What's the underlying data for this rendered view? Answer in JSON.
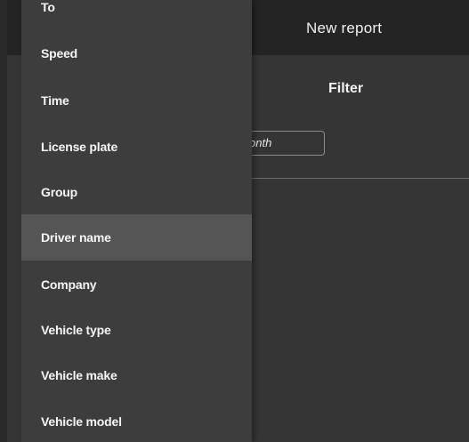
{
  "header": {
    "title": "New report"
  },
  "filter": {
    "title": "Filter",
    "period_value": "onth"
  },
  "dropdown": {
    "items": [
      {
        "label": "To"
      },
      {
        "label": "Speed"
      },
      {
        "label": "Time"
      },
      {
        "label": "License plate"
      },
      {
        "label": "Group"
      },
      {
        "label": "Driver name",
        "selected": true
      },
      {
        "label": "Company"
      },
      {
        "label": "Vehicle type"
      },
      {
        "label": "Vehicle make"
      },
      {
        "label": "Vehicle model"
      }
    ]
  },
  "colors": {
    "background": "#343434",
    "header": "#242424",
    "dropdown": "#3d3d3d",
    "selected_item": "#555555",
    "text": "#ffffff"
  }
}
